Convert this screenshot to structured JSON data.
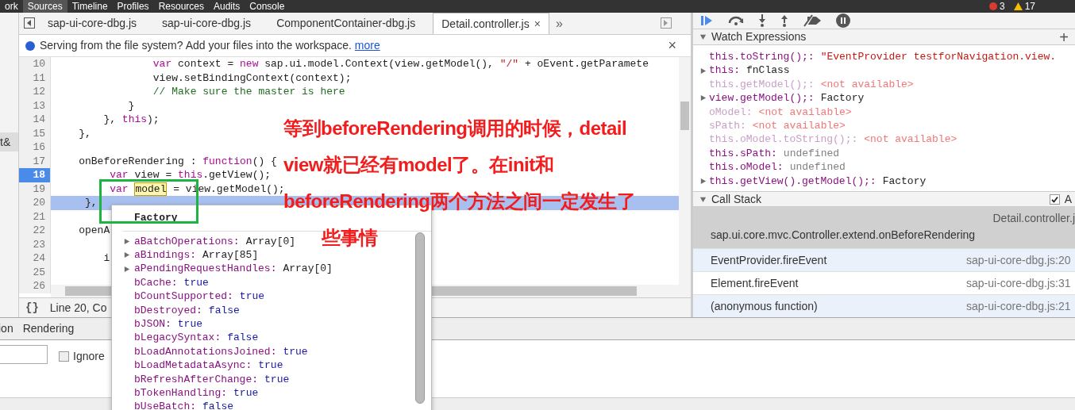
{
  "top_menu": [
    {
      "label": "ork",
      "selected": false
    },
    {
      "label": "Sources",
      "selected": true
    },
    {
      "label": "Timeline",
      "selected": false
    },
    {
      "label": "Profiles",
      "selected": false
    },
    {
      "label": "Resources",
      "selected": false
    },
    {
      "label": "Audits",
      "selected": false
    },
    {
      "label": "Console",
      "selected": false
    }
  ],
  "status_counts": {
    "errors": "3",
    "warnings": "17"
  },
  "left_strip": {
    "text": "t&"
  },
  "editor_tabs": [
    {
      "label": "sap-ui-core-dbg.js",
      "selected": false
    },
    {
      "label": "sap-ui-core-dbg.js",
      "selected": false
    },
    {
      "label": "ComponentContainer-dbg.js",
      "selected": false
    },
    {
      "label": "Detail.controller.js",
      "selected": true,
      "close": "×"
    }
  ],
  "more_tabs": "»",
  "info_bar": {
    "message": "Serving from the file system? Add your files into the workspace.",
    "link": "more",
    "close": "×"
  },
  "code_lines": [
    {
      "number": "10",
      "breakpoint": false,
      "current": false,
      "segments": [
        {
          "kind": "keyword",
          "text": "                var "
        },
        {
          "kind": "plain",
          "text": "context = "
        },
        {
          "kind": "keyword",
          "text": "new "
        },
        {
          "kind": "plain",
          "text": "sap.ui.model.Context(view.getModel(), "
        },
        {
          "kind": "string",
          "text": "\"/\""
        },
        {
          "kind": "plain",
          "text": " + oEvent.getParamete"
        }
      ]
    },
    {
      "number": "11",
      "breakpoint": false,
      "current": false,
      "segments": [
        {
          "kind": "plain",
          "text": "                view.setBindingContext(context);"
        }
      ]
    },
    {
      "number": "12",
      "breakpoint": false,
      "current": false,
      "segments": [
        {
          "kind": "comment",
          "text": "                // Make sure the master is here"
        }
      ]
    },
    {
      "number": "13",
      "breakpoint": false,
      "current": false,
      "segments": [
        {
          "kind": "plain",
          "text": "            }"
        }
      ]
    },
    {
      "number": "14",
      "breakpoint": false,
      "current": false,
      "segments": [
        {
          "kind": "plain",
          "text": "        }, "
        },
        {
          "kind": "keyword",
          "text": "this"
        },
        {
          "kind": "plain",
          "text": ");"
        }
      ]
    },
    {
      "number": "15",
      "breakpoint": false,
      "current": false,
      "segments": [
        {
          "kind": "plain",
          "text": "    },"
        }
      ]
    },
    {
      "number": "16",
      "breakpoint": false,
      "current": false
    },
    {
      "number": "17",
      "breakpoint": false,
      "current": false,
      "segments": [
        {
          "kind": "plain",
          "text": "    onBeforeRendering : "
        },
        {
          "kind": "keyword",
          "text": "function"
        },
        {
          "kind": "plain",
          "text": "() {"
        }
      ]
    },
    {
      "number": "18",
      "breakpoint": true,
      "current": false,
      "segments": [
        {
          "kind": "keyword",
          "text": "         var "
        },
        {
          "kind": "plain",
          "text": "view = "
        },
        {
          "kind": "keyword",
          "text": "this"
        },
        {
          "kind": "plain",
          "text": ".getView();"
        }
      ]
    },
    {
      "number": "19",
      "breakpoint": false,
      "current": false,
      "segments": [
        {
          "kind": "keyword",
          "text": "         var "
        },
        {
          "kind": "hover",
          "text": "model"
        },
        {
          "kind": "plain",
          "text": " = view.getModel();"
        }
      ]
    },
    {
      "number": "20",
      "breakpoint": false,
      "current": true,
      "segments": [
        {
          "kind": "plain",
          "text": "     },"
        }
      ]
    },
    {
      "number": "21",
      "breakpoint": false,
      "current": false
    },
    {
      "number": "22",
      "breakpoint": false,
      "current": false,
      "segments": [
        {
          "kind": "plain",
          "text": "    openA"
        }
      ]
    },
    {
      "number": "23",
      "breakpoint": false,
      "current": false
    },
    {
      "number": "24",
      "breakpoint": false,
      "current": false,
      "segments": [
        {
          "kind": "plain",
          "text": "        i"
        }
      ]
    },
    {
      "number": "25",
      "breakpoint": false,
      "current": false
    },
    {
      "number": "26",
      "breakpoint": false,
      "current": false
    }
  ],
  "status_bar": {
    "format_icon": "{}",
    "position": "Line 20, Co"
  },
  "popover": {
    "title": "Factory",
    "entries": [
      {
        "name": "aBatchOperations:",
        "value": "Array[0]",
        "kind": "object",
        "expandable": true
      },
      {
        "name": "aBindings:",
        "value": "Array[85]",
        "kind": "object",
        "expandable": true
      },
      {
        "name": "aPendingRequestHandles:",
        "value": "Array[0]",
        "kind": "object",
        "expandable": true
      },
      {
        "name": "bCache:",
        "value": "true",
        "kind": "literal",
        "expandable": false
      },
      {
        "name": "bCountSupported:",
        "value": "true",
        "kind": "literal",
        "expandable": false
      },
      {
        "name": "bDestroyed:",
        "value": "false",
        "kind": "literal",
        "expandable": false
      },
      {
        "name": "bJSON:",
        "value": "true",
        "kind": "literal",
        "expandable": false
      },
      {
        "name": "bLegacySyntax:",
        "value": "false",
        "kind": "literal",
        "expandable": false
      },
      {
        "name": "bLoadAnnotationsJoined:",
        "value": "true",
        "kind": "literal",
        "expandable": false
      },
      {
        "name": "bLoadMetadataAsync:",
        "value": "true",
        "kind": "literal",
        "expandable": false
      },
      {
        "name": "bRefreshAfterChange:",
        "value": "true",
        "kind": "literal",
        "expandable": false
      },
      {
        "name": "bTokenHandling:",
        "value": "true",
        "kind": "literal",
        "expandable": false
      },
      {
        "name": "bUseBatch:",
        "value": "false",
        "kind": "literal",
        "expandable": false
      }
    ]
  },
  "annotation": {
    "lines": [
      "等到beforeRendering调用的时候，detail",
      "view就已经有model了。在init和",
      "beforeRendering两个方法之间一定发生了",
      "些事情"
    ]
  },
  "watch": {
    "title": "Watch Expressions",
    "expanded": true,
    "add": "+",
    "entries": [
      {
        "expression": "this.toString();:",
        "value": "\"EventProvider testforNavigation.view.",
        "kind": "string",
        "expandable": false
      },
      {
        "expression": "this:",
        "value": "fnClass",
        "kind": "object",
        "expandable": true
      },
      {
        "expression": "this.getModel();:",
        "value": "<not available>",
        "kind": "unavailable",
        "expandable": false
      },
      {
        "expression": "view.getModel();:",
        "value": "Factory",
        "kind": "object",
        "expandable": true
      },
      {
        "expression": "oModel:",
        "value": "<not available>",
        "kind": "unavailable",
        "expandable": false
      },
      {
        "expression": "sPath:",
        "value": "<not available>",
        "kind": "unavailable",
        "expandable": false
      },
      {
        "expression": "this.oModel.toString();:",
        "value": "<not available>",
        "kind": "unavailable",
        "expandable": false
      },
      {
        "expression": "this.sPath:",
        "value": "undefined",
        "kind": "undefined",
        "expandable": false
      },
      {
        "expression": "this.oModel:",
        "value": "undefined",
        "kind": "undefined",
        "expandable": false
      },
      {
        "expression": "this.getView().getModel();:",
        "value": "Factory",
        "kind": "object",
        "expandable": true
      }
    ]
  },
  "call_stack": {
    "title": "Call Stack",
    "expanded": true,
    "async": {
      "label": "A",
      "checked": true
    },
    "frames": [
      {
        "function": "sap.ui.core.mvc.Controller.extend.onBeforeRendering",
        "location": "Detail.controller.j",
        "selected": true
      },
      {
        "function": "EventProvider.fireEvent",
        "location": "sap-ui-core-dbg.js:20",
        "selected": false
      },
      {
        "function": "Element.fireEvent",
        "location": "sap-ui-core-dbg.js:31",
        "selected": false
      },
      {
        "function": "(anonymous function)",
        "location": "sap-ui-core-dbg.js:21",
        "selected": false
      }
    ]
  },
  "drawer": {
    "tabs": [
      {
        "label": "ion",
        "selected": false
      },
      {
        "label": "Rendering",
        "selected": false
      }
    ],
    "checkbox": {
      "label": "Ignore",
      "checked": false
    }
  }
}
